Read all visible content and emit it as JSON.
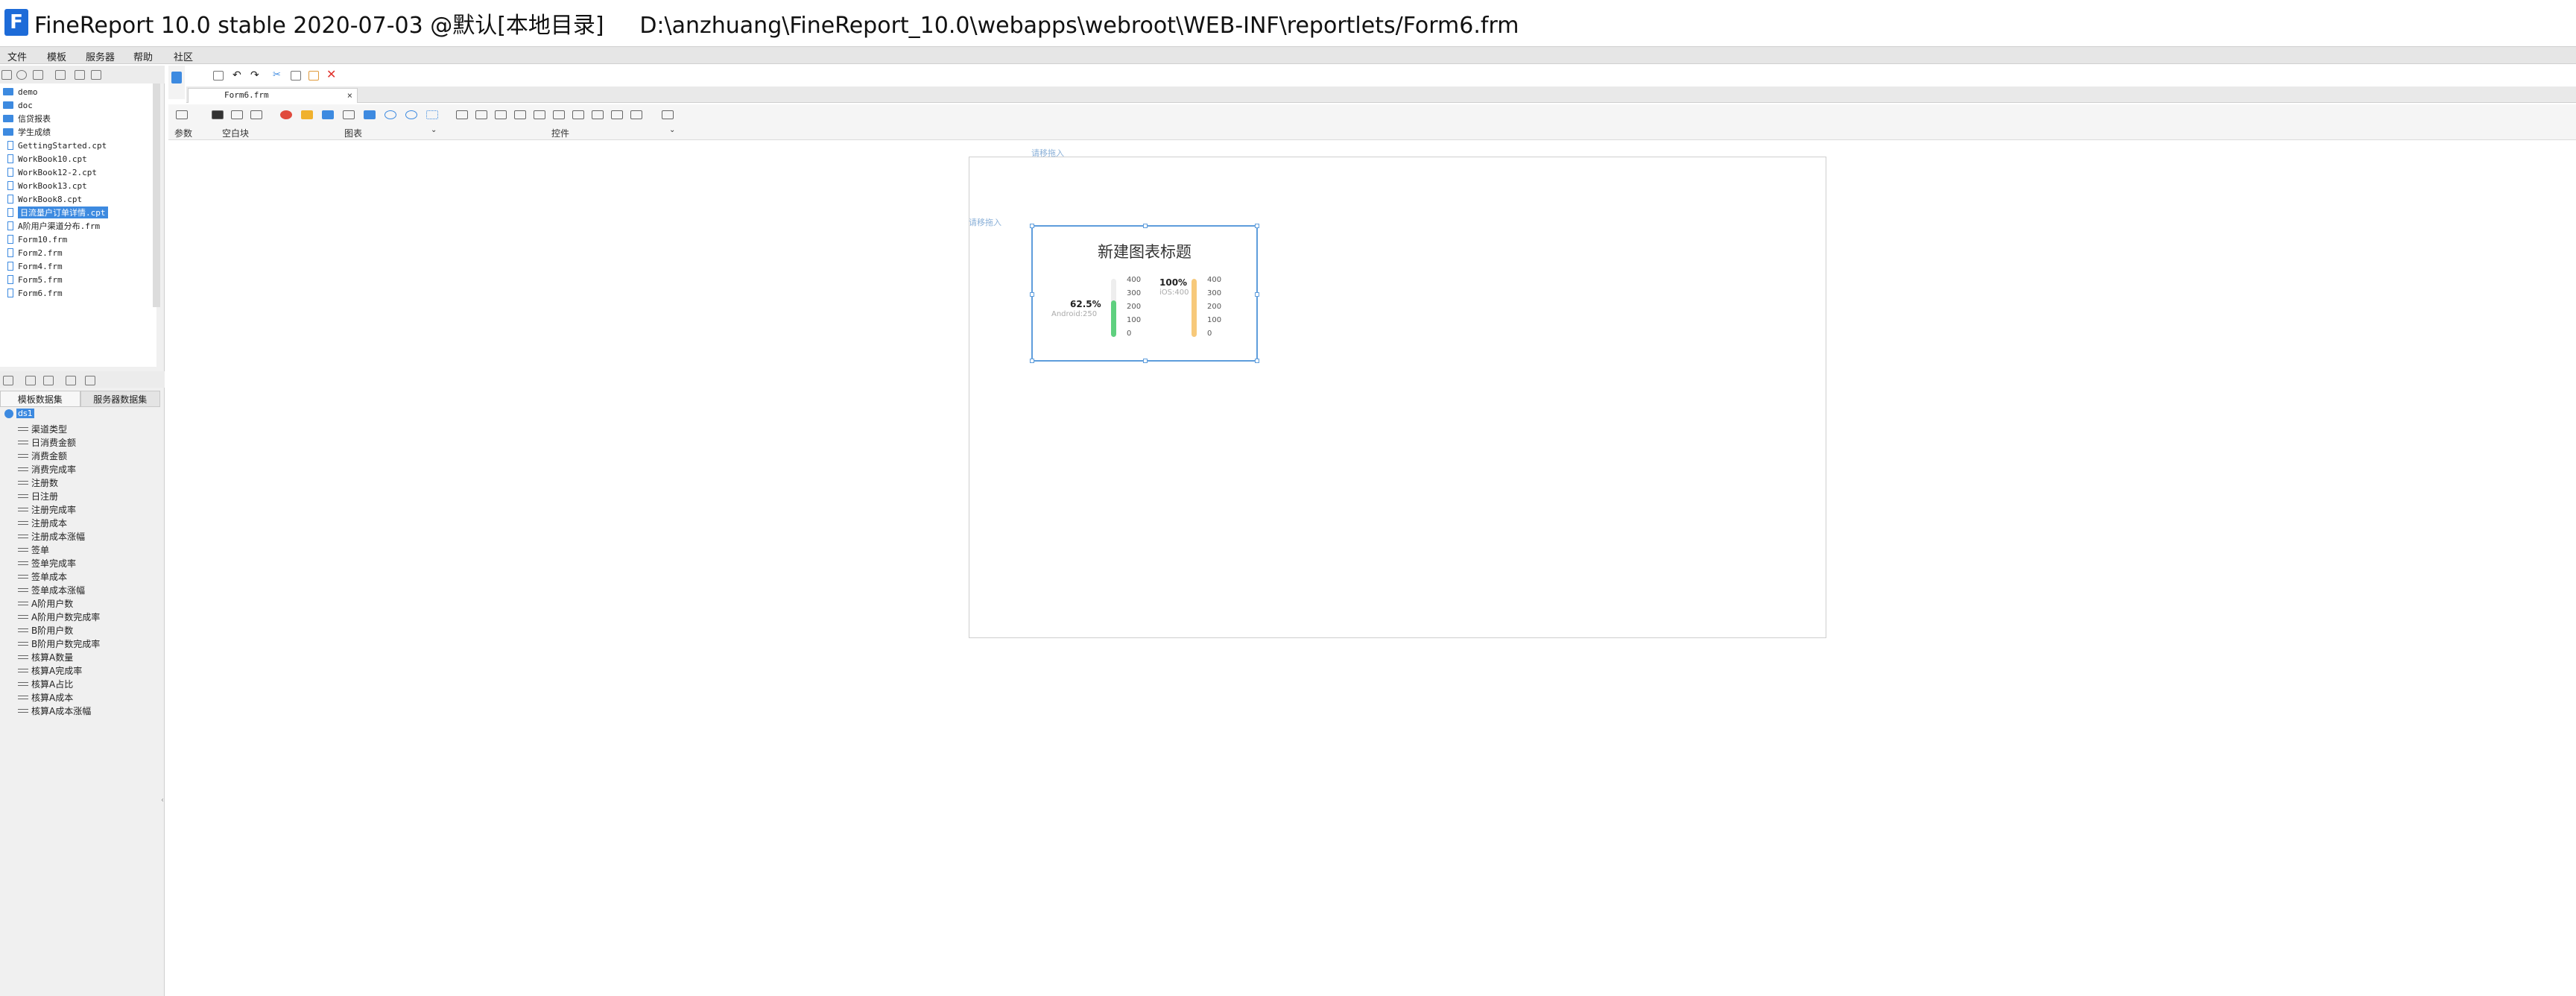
{
  "window": {
    "title": "FineReport 10.0 stable 2020-07-03 @默认[本地目录]     D:\\anzhuang\\FineReport_10.0\\webapps\\webroot\\WEB-INF\\reportlets/Form6.frm"
  },
  "menu": [
    "文件",
    "模板",
    "服务器",
    "帮助",
    "社区"
  ],
  "file_tree": [
    {
      "type": "folder",
      "label": "demo"
    },
    {
      "type": "folder",
      "label": "doc"
    },
    {
      "type": "folder",
      "label": "信贷报表"
    },
    {
      "type": "folder",
      "label": "学生成绩"
    },
    {
      "type": "file",
      "label": "GettingStarted.cpt"
    },
    {
      "type": "file",
      "label": "WorkBook10.cpt"
    },
    {
      "type": "file",
      "label": "WorkBook12-2.cpt"
    },
    {
      "type": "file",
      "label": "WorkBook13.cpt"
    },
    {
      "type": "file",
      "label": "WorkBook8.cpt"
    },
    {
      "type": "file",
      "label": "日流量户订单详情.cpt",
      "selected": true
    },
    {
      "type": "file",
      "label": "A阶用户渠道分布.frm"
    },
    {
      "type": "file",
      "label": "Form10.frm"
    },
    {
      "type": "file",
      "label": "Form2.frm"
    },
    {
      "type": "file",
      "label": "Form4.frm"
    },
    {
      "type": "file",
      "label": "Form5.frm"
    },
    {
      "type": "file",
      "label": "Form6.frm"
    }
  ],
  "datasource_tabs": {
    "template": "模板数据集",
    "server": "服务器数据集"
  },
  "dataset": {
    "name": "ds1",
    "fields": [
      "渠道类型",
      "日消费金额",
      "消费金额",
      "消费完成率",
      "注册数",
      "日注册",
      "注册完成率",
      "注册成本",
      "注册成本涨幅",
      "签单",
      "签单完成率",
      "签单成本",
      "签单成本涨幅",
      "A阶用户数",
      "A阶用户数完成率",
      "B阶用户数",
      "B阶用户数完成率",
      "核算A数量",
      "核算A完成率",
      "核算A占比",
      "核算A成本",
      "核算A成本涨幅"
    ]
  },
  "doc_tab": {
    "label": "Form6.frm",
    "close": "×"
  },
  "widget_groups": {
    "params": "参数",
    "blank": "空白块",
    "chart": "图表",
    "control": "控件"
  },
  "canvas": {
    "hint_top": "请移拖入",
    "hint_left": "请移拖入"
  },
  "chart_data": {
    "type": "gauge",
    "title": "新建图表标题",
    "series": [
      {
        "pct": "62.5%",
        "subtitle": "Android:250",
        "value": 250,
        "max": 400,
        "color": "#5fd07f"
      },
      {
        "pct": "100%",
        "subtitle": "iOS:400",
        "value": 400,
        "max": 400,
        "color": "#f7c97a"
      }
    ],
    "ticks": [
      "400",
      "300",
      "200",
      "100",
      "0"
    ]
  }
}
